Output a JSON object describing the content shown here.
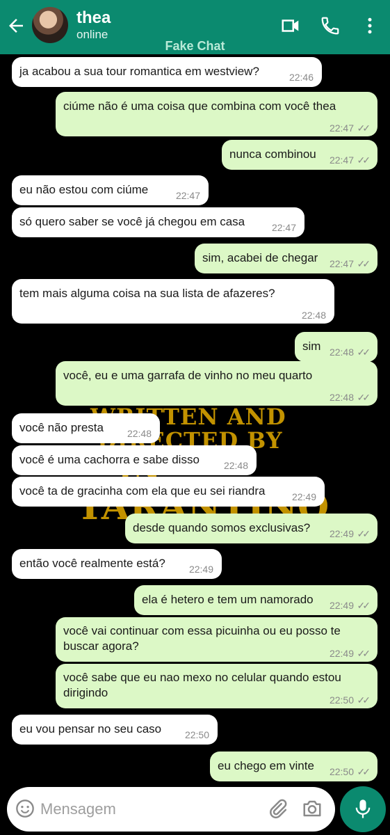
{
  "header": {
    "contact_name": "thea",
    "status": "online",
    "watermark": "Fake Chat",
    "icons": [
      "back-arrow-icon",
      "video-call-icon",
      "phone-icon",
      "more-options-icon"
    ],
    "color": "#0b8a6f"
  },
  "background_text": [
    "WRITTEN AND",
    "DIRECTED BY",
    "IN",
    "TARANTINO"
  ],
  "messages": [
    {
      "dir": "in",
      "text": "ja acabou a sua tour romantica em westview?",
      "time": "22:46"
    },
    {
      "dir": "out",
      "text": "ciúme não é uma coisa que combina com você thea",
      "time": "22:47",
      "ticks": "✓✓"
    },
    {
      "dir": "out",
      "text": "nunca combinou",
      "time": "22:47",
      "ticks": "✓✓"
    },
    {
      "dir": "in",
      "text": "eu não estou com ciúme",
      "time": "22:47"
    },
    {
      "dir": "in",
      "text": "só quero saber se você já chegou em casa",
      "time": "22:47"
    },
    {
      "dir": "out",
      "text": "sim, acabei de chegar",
      "time": "22:47",
      "ticks": "✓✓"
    },
    {
      "dir": "in",
      "text": "tem mais alguma coisa na sua lista de afazeres?",
      "time": "22:48"
    },
    {
      "dir": "out",
      "text": "sim",
      "time": "22:48",
      "ticks": "✓✓"
    },
    {
      "dir": "out",
      "text": "você, eu e uma garrafa de vinho no meu quarto",
      "time": "22:48",
      "ticks": "✓✓"
    },
    {
      "dir": "in",
      "text": "você não presta",
      "time": "22:48"
    },
    {
      "dir": "in",
      "text": "você é uma cachorra e sabe disso",
      "time": "22:48"
    },
    {
      "dir": "in",
      "text": "você ta de gracinha com ela que eu sei riandra",
      "time": "22:49"
    },
    {
      "dir": "out",
      "text": "desde quando somos exclusivas?",
      "time": "22:49",
      "ticks": "✓✓"
    },
    {
      "dir": "in",
      "text": "então você realmente está?",
      "time": "22:49"
    },
    {
      "dir": "out",
      "text": "ela é hetero e tem um namorado",
      "time": "22:49",
      "ticks": "✓✓"
    },
    {
      "dir": "out",
      "text": "você vai continuar com essa picuinha ou eu posso te\nbuscar agora?",
      "time": "22:49",
      "ticks": "✓✓"
    },
    {
      "dir": "out",
      "text": "você sabe que eu nao mexo no celular quando estou\ndirigindo",
      "time": "22:50",
      "ticks": "✓✓"
    },
    {
      "dir": "in",
      "text": "eu vou pensar no seu caso",
      "time": "22:50"
    },
    {
      "dir": "out",
      "text": "eu chego em vinte",
      "time": "22:50",
      "ticks": "✓✓"
    }
  ],
  "composer": {
    "placeholder": "Mensagem",
    "icons": [
      "emoji-icon",
      "attach-icon",
      "camera-icon",
      "microphone-icon"
    ]
  }
}
